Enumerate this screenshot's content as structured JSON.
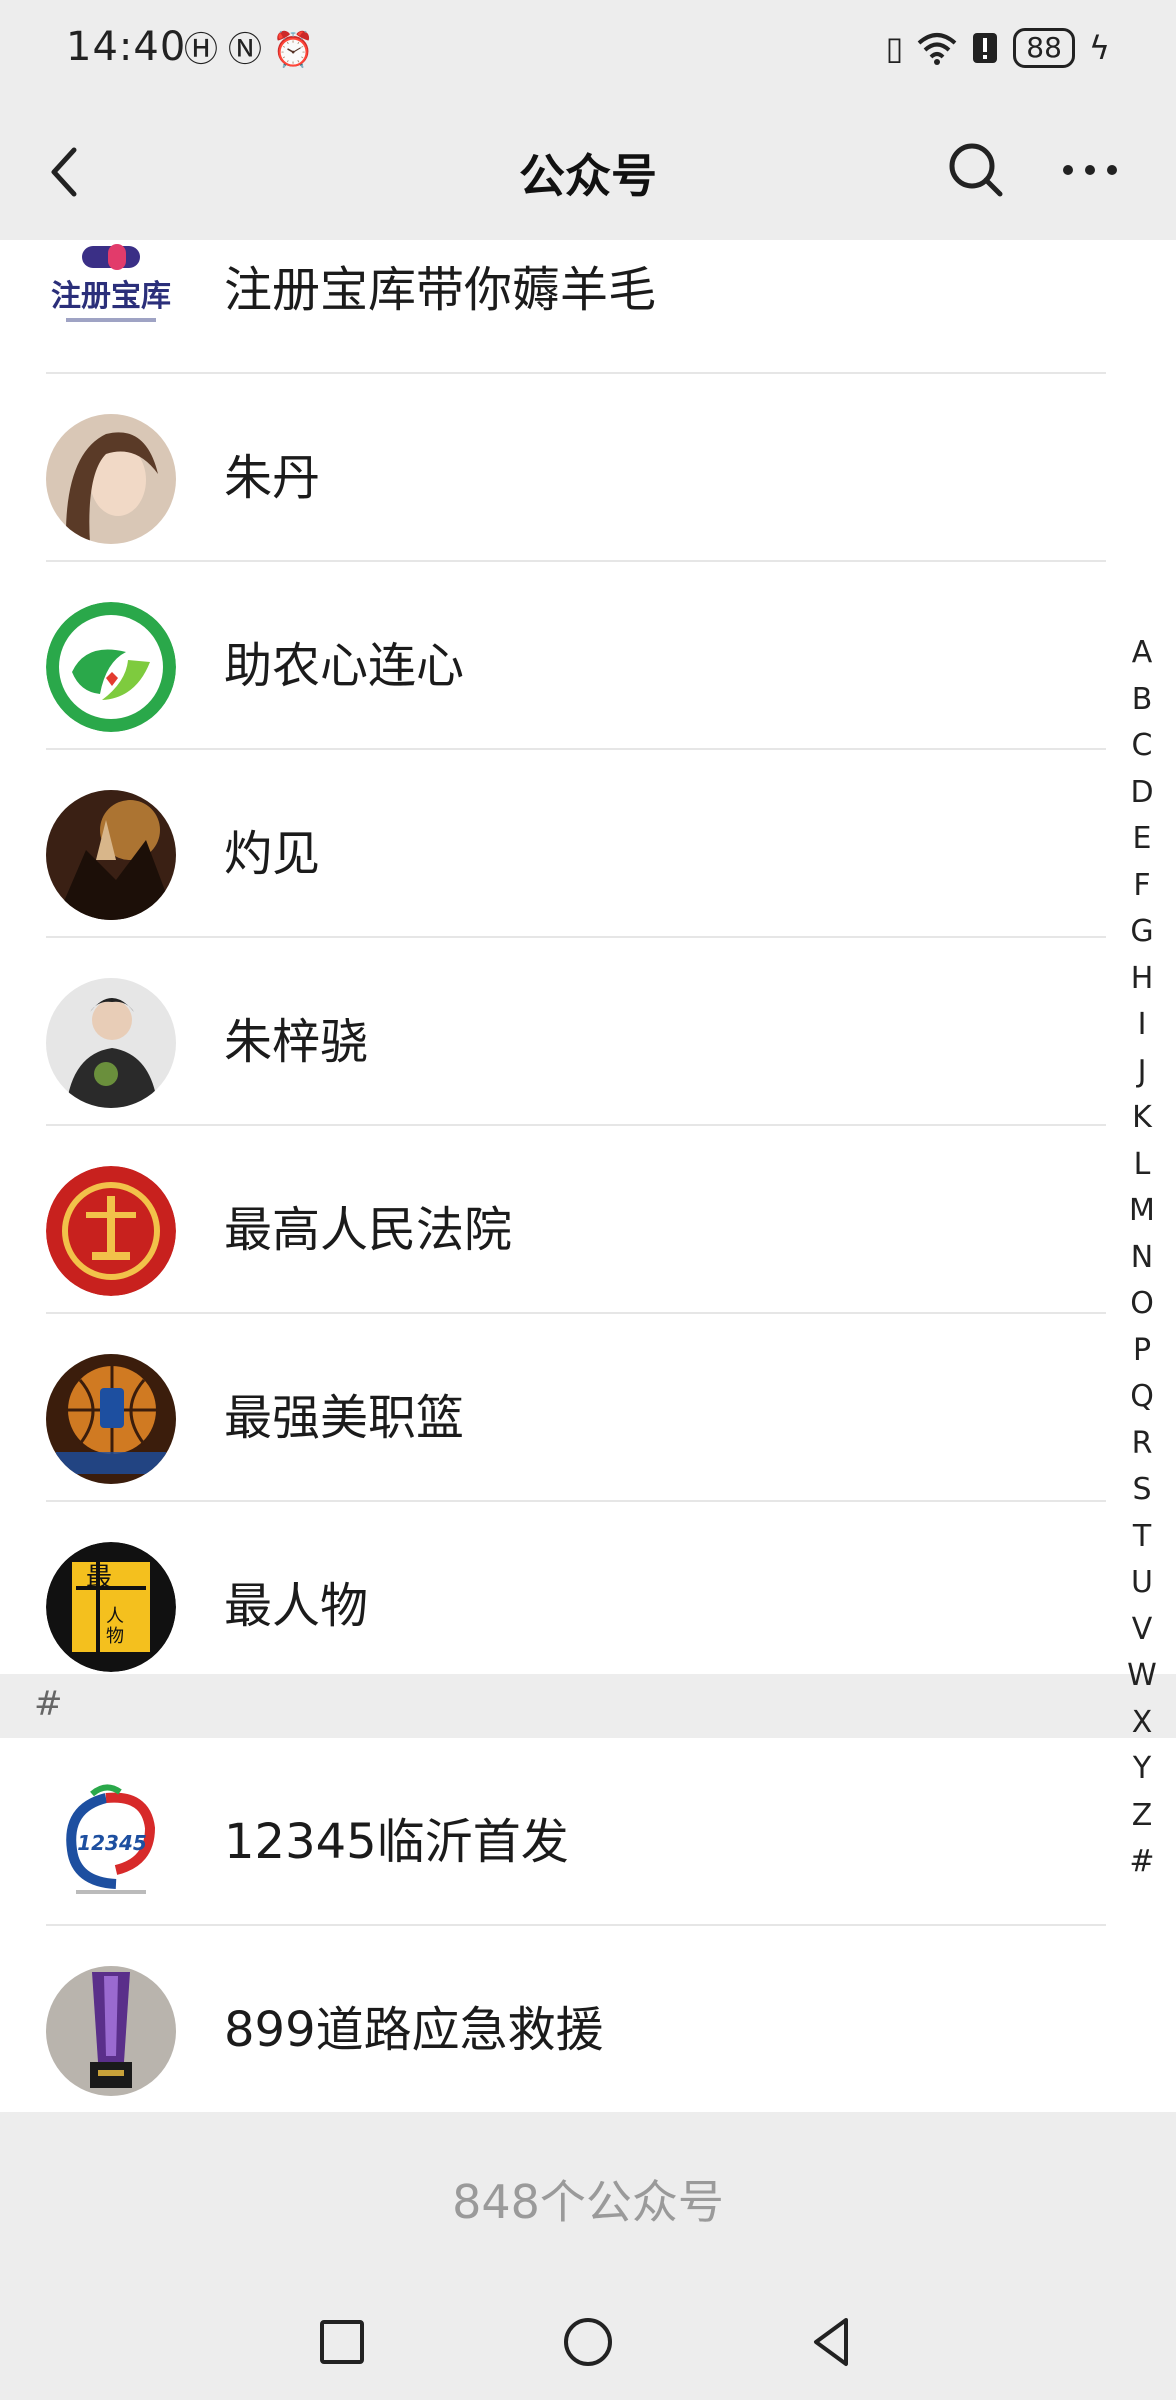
{
  "status_bar": {
    "time": "14:40",
    "battery": "88",
    "left_icons": [
      "hd-icon",
      "nfc-icon",
      "alarm-icon"
    ],
    "right_icons": [
      "vibrate-icon",
      "wifi-icon",
      "alert-icon"
    ]
  },
  "nav": {
    "title": "公众号"
  },
  "accounts": [
    {
      "name": "注册宝库带你薅羊毛",
      "avatar": "logo-zhucebaoku-icon",
      "color": "#2b2f7a"
    },
    {
      "name": "朱丹",
      "avatar": "portrait-icon",
      "color": "#b89c86"
    },
    {
      "name": "助农心连心",
      "avatar": "green-leaf-logo-icon",
      "color": "#2aa84a"
    },
    {
      "name": "灼见",
      "avatar": "painting-icon",
      "color": "#5a3320"
    },
    {
      "name": "朱梓骁",
      "avatar": "portrait-icon",
      "color": "#4a4a4a"
    },
    {
      "name": "最高人民法院",
      "avatar": "court-emblem-icon",
      "color": "#c8211e"
    },
    {
      "name": "最强美职篮",
      "avatar": "basketball-icon",
      "color": "#a35a1c"
    },
    {
      "name": "最人物",
      "avatar": "book-logo-icon",
      "color": "#f4c01e"
    }
  ],
  "section_hash": {
    "label": "#"
  },
  "hash_accounts": [
    {
      "name": "12345临沂首发",
      "avatar": "hotline-logo-icon",
      "color": "#d72a2a"
    },
    {
      "name": "899道路应急救援",
      "avatar": "trophy-icon",
      "color": "#5a2f8a"
    }
  ],
  "alpha_index": [
    "A",
    "B",
    "C",
    "D",
    "E",
    "F",
    "G",
    "H",
    "I",
    "J",
    "K",
    "L",
    "M",
    "N",
    "O",
    "P",
    "Q",
    "R",
    "S",
    "T",
    "U",
    "V",
    "W",
    "X",
    "Y",
    "Z",
    "#"
  ],
  "footer": {
    "count_text": "848个公众号"
  }
}
